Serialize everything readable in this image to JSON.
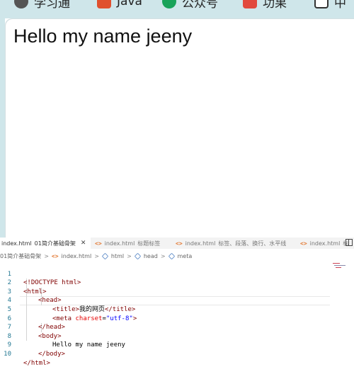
{
  "browser": {
    "bookmarks": [
      {
        "label": "学习通",
        "icon": "xuexitong-icon"
      },
      {
        "label": "Java",
        "icon": "java-icon"
      },
      {
        "label": "公众号",
        "icon": "wechat-icon"
      },
      {
        "label": "功果",
        "icon": "puzzle-icon"
      },
      {
        "label": "中",
        "icon": "translate-icon"
      }
    ],
    "page_heading": "Hello my name jeeny"
  },
  "editor": {
    "tabs": [
      {
        "icon": "<>",
        "label": "index.html",
        "folder": "01简介基础骨架",
        "active": true,
        "close": "✕"
      },
      {
        "icon": "<>",
        "label": "index.html",
        "folder": "标题标签",
        "active": false
      },
      {
        "icon": "<>",
        "label": "index.html",
        "folder": "标签、段落、换行、水平线",
        "active": false
      },
      {
        "icon": "<>",
        "label": "index.html",
        "folder": "标",
        "active": false
      }
    ],
    "breadcrumb": {
      "folder": "01简介基础骨架",
      "sep": ">",
      "file_icon": "<>",
      "file": "index.html",
      "items": [
        "html",
        "head",
        "meta"
      ]
    },
    "lines": [
      {
        "n": "1",
        "t": "<!DOCTYPE html>"
      },
      {
        "n": "2",
        "t": "<html>"
      },
      {
        "n": "3",
        "t": "<head>"
      },
      {
        "n": "4",
        "open": "<title>",
        "text": "我的网页",
        "close": "</title>"
      },
      {
        "n": "5",
        "open": "<meta",
        "attr": "charset",
        "eq": "=",
        "val": "\"utf-8\"",
        "end": ">"
      },
      {
        "n": "6",
        "t": "</head>"
      },
      {
        "n": "7",
        "t": "<body>"
      },
      {
        "n": "8",
        "text": "Hello my name jeeny"
      },
      {
        "n": "9",
        "t": "</body>"
      },
      {
        "n": "10",
        "t": "</html>"
      }
    ]
  },
  "colors": {
    "tag": "#800000",
    "attribute": "#e50000",
    "string": "#0000ff",
    "line_number": "#237893",
    "browser_chrome": "#cfe6ea"
  }
}
